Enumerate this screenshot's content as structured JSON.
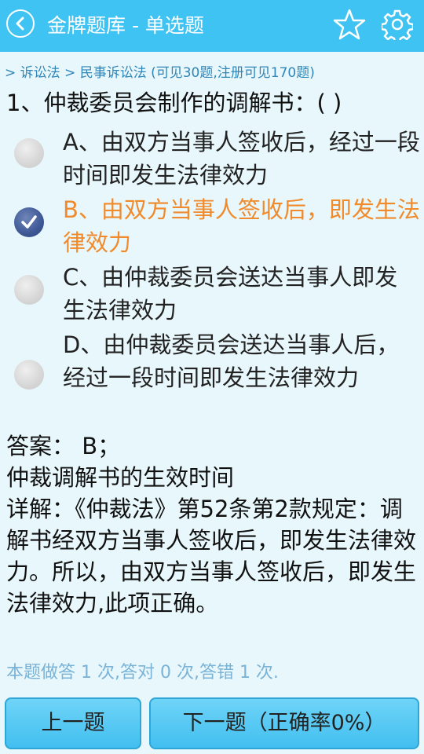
{
  "header": {
    "title": "金牌题库  -  单选题",
    "back_icon": "back-arrow-icon",
    "favorite_icon": "star-icon",
    "settings_icon": "gear-icon"
  },
  "breadcrumb": "> 诉讼法 > 民事诉讼法 (可见30题,注册可见170题)",
  "question": "1、仲裁委员会制作的调解书：( )",
  "options": [
    {
      "label": "A、由双方当事人签收后，经过一段时间即发生法律效力",
      "selected": false
    },
    {
      "label": "B、由双方当事人签收后，即发生法律效力",
      "selected": true
    },
    {
      "label": "C、由仲裁委员会送达当事人即发生法律效力",
      "selected": false
    },
    {
      "label": "D、由仲裁委员会送达当事人后，经过一段时间即发生法律效力",
      "selected": false
    }
  ],
  "answer": {
    "result": "答案： B；",
    "topic": "仲裁调解书的生效时间",
    "explanation": "详解：《仲裁法》第52条第2款规定：调解书经双方当事人签收后，即发生法律效力。所以，由双方当事人签收后，即发生法律效力,此项正确。"
  },
  "stats": "本题做答 1 次,答对 0 次,答错 1 次.",
  "buttons": {
    "prev": "上一题",
    "next": "下一题（正确率0%）"
  },
  "colors": {
    "header_bg": "#3ec3f2",
    "page_bg": "#e8f7fc",
    "selected_text": "#f08a2a",
    "breadcrumb": "#2f86b8"
  }
}
